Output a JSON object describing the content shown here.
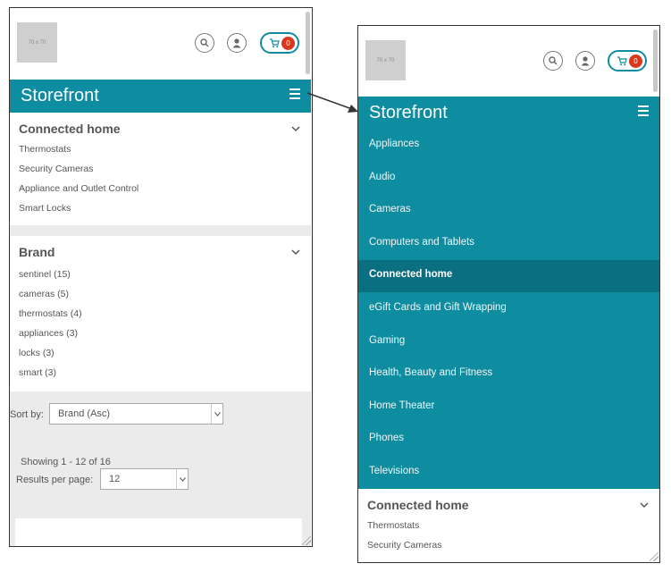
{
  "left_screen": {
    "logo_text": "70 x 70",
    "cart_count": "0",
    "brand_title": "Storefront",
    "category_facet": {
      "title": "Connected home",
      "items": [
        "Thermostats",
        "Security Cameras",
        "Appliance and Outlet Control",
        "Smart Locks"
      ]
    },
    "brand_facet": {
      "title": "Brand",
      "items": [
        "sentinel (15)",
        "cameras (5)",
        "thermostats (4)",
        "appliances (3)",
        "locks (3)",
        "smart (3)"
      ]
    },
    "sort_label": "Sort by:",
    "sort_value": "Brand (Asc)",
    "showing_text": "Showing 1 - 12 of 16",
    "results_per_page_label": "Results per page:",
    "results_per_page_value": "12"
  },
  "right_screen": {
    "logo_text": "70 x 70",
    "cart_count": "0",
    "brand_title": "Storefront",
    "menu_items": [
      "Appliances",
      "Audio",
      "Cameras",
      "Computers and Tablets",
      "Connected home",
      "eGift Cards and Gift Wrapping",
      "Gaming",
      "Health, Beauty and Fitness",
      "Home Theater",
      "Phones",
      "Televisions"
    ],
    "active_menu_item": "Connected home",
    "category_facet": {
      "title": "Connected home",
      "items": [
        "Thermostats",
        "Security Cameras"
      ]
    }
  },
  "colors": {
    "brand_teal": "#0e8ca0",
    "menu_active": "#0a6f80",
    "cart_badge": "#d8391e"
  },
  "icons": [
    "search-icon",
    "user-icon",
    "cart-icon",
    "hamburger-icon",
    "chevron-down-icon",
    "arrow-icon"
  ]
}
